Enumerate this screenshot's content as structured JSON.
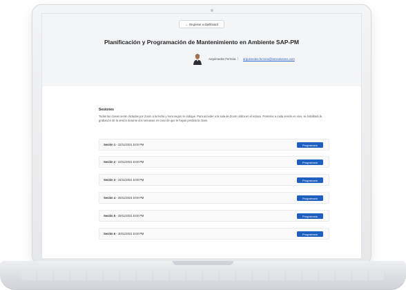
{
  "header": {
    "back_label": "Regresar a dashboard",
    "course_title": "Planificación y Programación de Mantenimiento en Ambiente SAP-PM",
    "instructor_name": "Arquímedes Ferreira",
    "separator": "|",
    "instructor_email": "arquimedes.ferreira@inmsolutions.com"
  },
  "sessions": {
    "title": "Sesiones",
    "description": "Todas las clases serán dictadas por Zoom a la fecha y hora según se indique. Para acceder a la sala de Zoom utiliza en el enlace. Posterior a cada sesión en vivo, se habilitará la grabación de la sesión durante dos semanas en caso de que te hayas perdido la clase.",
    "items": [
      {
        "label": "Sesión 1",
        "datetime": " - 22/11/2021 5:00 PM",
        "status": "Programado"
      },
      {
        "label": "Sesión 2",
        "datetime": " - 23/11/2021 5:00 PM",
        "status": "Programado"
      },
      {
        "label": "Sesión 3",
        "datetime": " - 24/11/2021 5:00 PM",
        "status": "Programado"
      },
      {
        "label": "Sesión 4",
        "datetime": " - 25/11/2021 5:00 PM",
        "status": "Programado"
      },
      {
        "label": "Sesión 5",
        "datetime": " - 29/11/2021 5:00 PM",
        "status": "Programado"
      },
      {
        "label": "Sesión 6",
        "datetime": " - 30/11/2021 5:00 PM",
        "status": "Programado"
      }
    ]
  },
  "colors": {
    "badge": "#1f5fbf",
    "link": "#2b63c6"
  },
  "icons": {
    "back": "arrow-left-icon",
    "avatar": "instructor-avatar"
  }
}
